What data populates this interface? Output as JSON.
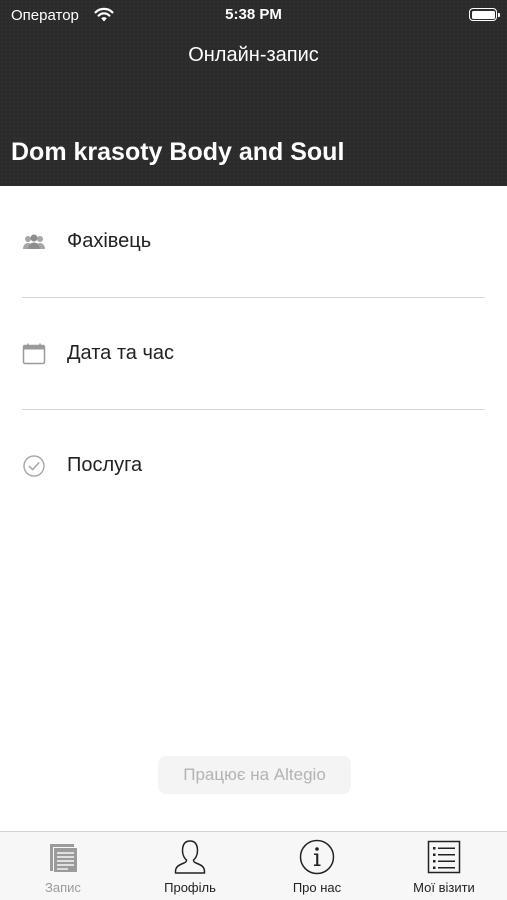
{
  "status_bar": {
    "carrier": "Оператор",
    "time": "5:38 PM"
  },
  "header": {
    "title": "Онлайн-запис",
    "salon_name": "Dom krasoty Body and Soul"
  },
  "menu": [
    {
      "icon": "people-icon",
      "label": "Фахівець"
    },
    {
      "icon": "calendar-icon",
      "label": "Дата та час"
    },
    {
      "icon": "check-circle-icon",
      "label": "Послуга"
    }
  ],
  "powered_by": "Працює на Altegio",
  "tabbar": [
    {
      "icon": "document-icon",
      "label": "Запис",
      "active": true
    },
    {
      "icon": "person-icon",
      "label": "Профіль",
      "active": false
    },
    {
      "icon": "info-icon",
      "label": "Про нас",
      "active": false
    },
    {
      "icon": "list-icon",
      "label": "Мої візити",
      "active": false
    }
  ],
  "colors": {
    "header_bg": "#2b2b2b",
    "tab_active": "#9b9b9b",
    "icon_gray": "#9a9a9a"
  }
}
